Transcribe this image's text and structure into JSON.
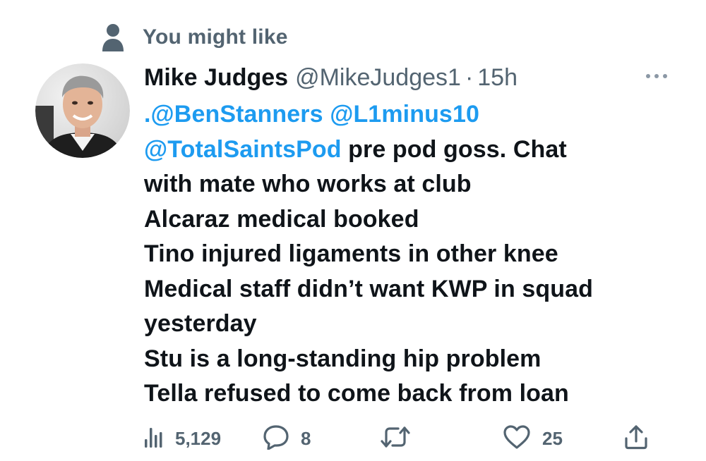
{
  "context": {
    "label": "You might like",
    "icon": "person-icon"
  },
  "author": {
    "display_name": "Mike Judges",
    "handle": "@MikeJudges1",
    "separator": "·",
    "time": "15h",
    "avatar": "avatar-photo"
  },
  "tweet": {
    "mentions": [
      ".@BenStanners",
      "@L1minus10",
      "@TotalSaintsPod"
    ],
    "text_after_mentions": " pre pod goss. Chat",
    "lines": [
      "with mate who works at club",
      "Alcaraz medical booked",
      "Tino injured ligaments in other knee",
      "Medical staff didn’t want KWP in squad",
      "yesterday",
      "Stu is a long-standing hip problem",
      "Tella refused to come back from loan"
    ]
  },
  "actions": {
    "views": {
      "count": "5,129",
      "icon": "views-icon"
    },
    "reply": {
      "count": "8",
      "icon": "reply-icon"
    },
    "retweet": {
      "count": "",
      "icon": "retweet-icon"
    },
    "like": {
      "count": "25",
      "icon": "heart-icon"
    },
    "share": {
      "icon": "share-icon"
    }
  },
  "colors": {
    "text": "#0f1419",
    "secondary": "#536471",
    "link": "#1d9bf0",
    "background": "#ffffff"
  }
}
